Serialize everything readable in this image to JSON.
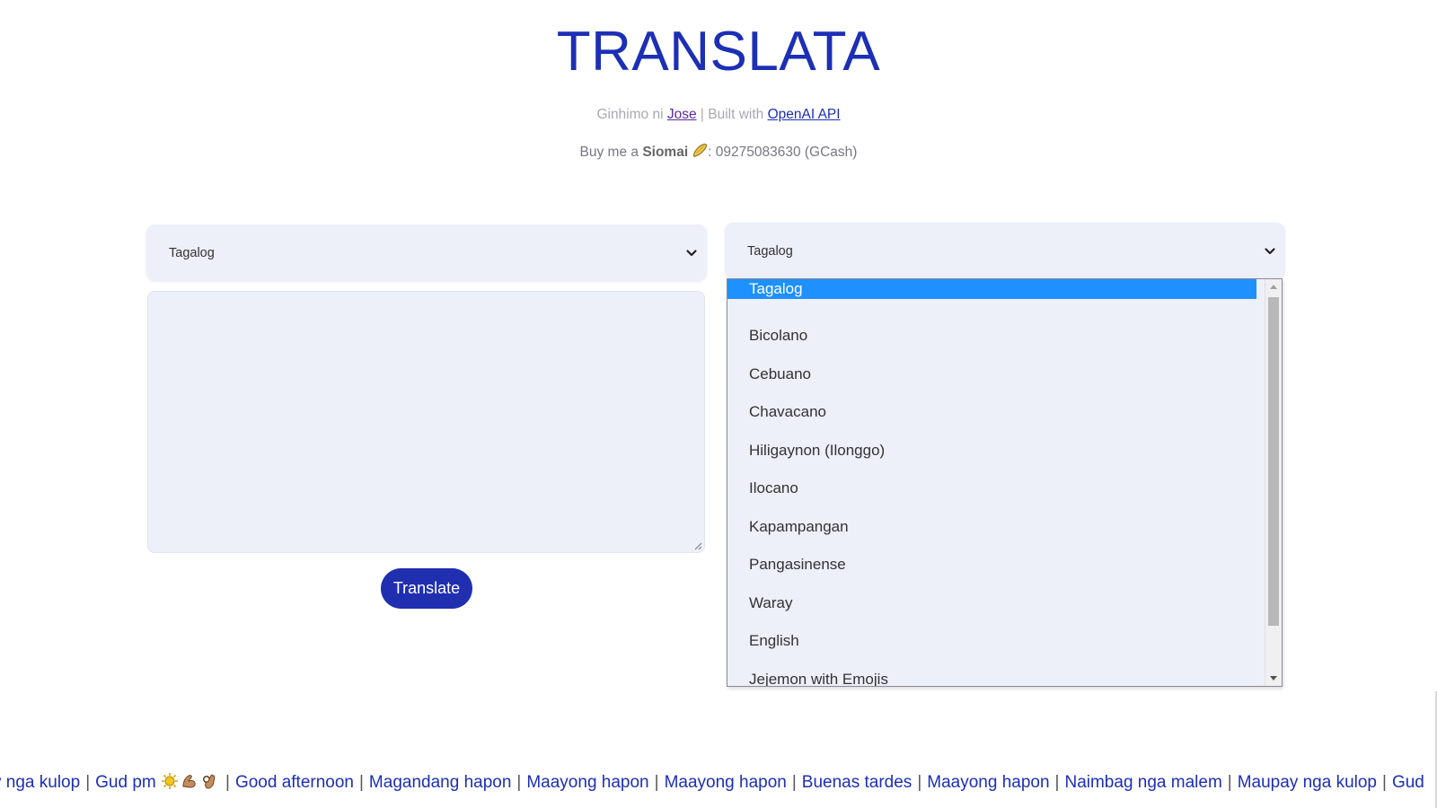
{
  "header": {
    "title": "TRANSLATA",
    "credit_prefix": "Ginhimo ni ",
    "author_link": "Jose",
    "credit_middle": " | Built with ",
    "api_link": "OpenAI API",
    "support_prefix": "Buy me a ",
    "support_item": "Siomai",
    "support_suffix": ": 09275083630 (GCash)"
  },
  "source": {
    "selected_language": "Tagalog",
    "text_value": "",
    "translate_label": "Translate"
  },
  "target": {
    "selected_language": "Tagalog",
    "options": [
      "Tagalog",
      "Bicolano",
      "Cebuano",
      "Chavacano",
      "Hiligaynon (Ilonggo)",
      "Ilocano",
      "Kapampangan",
      "Pangasinense",
      "Waray",
      "English",
      "Jejemon with Emojis"
    ]
  },
  "ticker": {
    "items": [
      "y nga kulop",
      "Gud pm",
      "Good afternoon",
      "Magandang hapon",
      "Maayong hapon",
      "Maayong hapon",
      "Buenas tardes",
      "Maayong hapon",
      "Naimbag nga malem",
      "Maupay nga kulop",
      "Gud"
    ],
    "separator": "|",
    "emoji_names": [
      "sun-icon",
      "flexed-arm-icon",
      "ok-hand-icon"
    ]
  },
  "colors": {
    "brand_blue": "#1c2fb5",
    "panel_bg": "#edeff9",
    "selection_blue": "#1e90ff"
  }
}
